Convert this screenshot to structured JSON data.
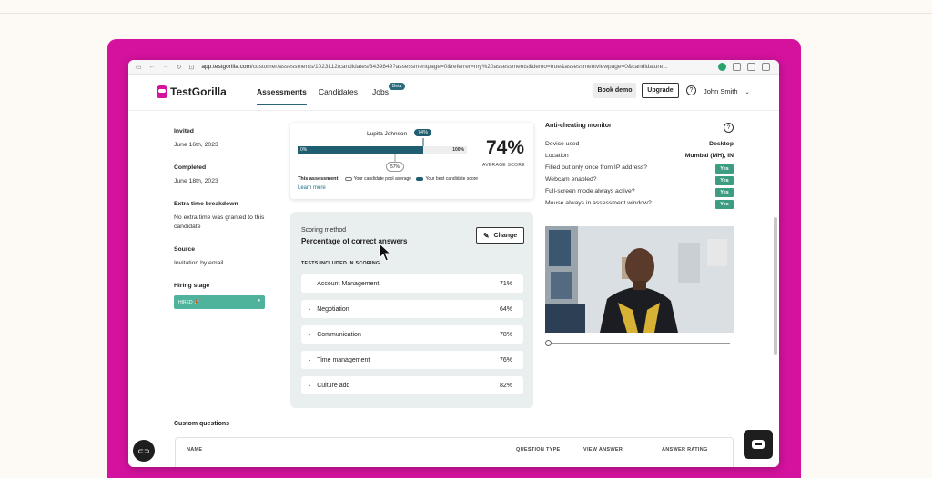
{
  "browser": {
    "url_host": "app.testgorilla.com",
    "url_path": "/customer/assessments/1023112/candidates/3439849?assessmentpage=0&referrer=my%20assessments&demo=true&assessmentviewpage=0&candidature..."
  },
  "header": {
    "logo": "TestGorilla",
    "nav": [
      "Assessments",
      "Candidates",
      "Jobs"
    ],
    "beta": "Beta",
    "book_demo": "Book demo",
    "upgrade": "Upgrade",
    "help": "?",
    "user": "John Smith"
  },
  "details": {
    "invited_label": "Invited",
    "invited_value": "June 16th, 2023",
    "completed_label": "Completed",
    "completed_value": "June 18th, 2023",
    "extra_label": "Extra time breakdown",
    "extra_value": "No extra time was granted to this candidate",
    "source_label": "Source",
    "source_value": "Invitation by email",
    "stage_label": "Hiring stage",
    "stage_value": "HIRED 🎉"
  },
  "score": {
    "candidate": "Lupita Johnson",
    "candidate_pct": "74%",
    "candidate_fraction": 0.74,
    "bar_min": "0%",
    "bar_max": "100%",
    "pool_avg": "57%",
    "big": "74%",
    "big_label": "AVERAGE SCORE",
    "legend_title": "This assessment:",
    "legend_pool": "Your candidate pool average",
    "legend_best": "Your best candidate score",
    "learn_more": "Learn more"
  },
  "scoring": {
    "method_label": "Scoring method",
    "method_value": "Percentage of correct answers",
    "change": "Change",
    "tests_label": "TESTS INCLUDED IN SCORING",
    "tests": [
      {
        "name": "Account Management",
        "pct": "71%"
      },
      {
        "name": "Negotiation",
        "pct": "64%"
      },
      {
        "name": "Communication",
        "pct": "78%"
      },
      {
        "name": "Time management",
        "pct": "76%"
      },
      {
        "name": "Culture add",
        "pct": "82%"
      }
    ]
  },
  "anticheat": {
    "title": "Anti-cheating monitor",
    "rows": [
      {
        "label": "Device used",
        "value": "Desktop"
      },
      {
        "label": "Location",
        "value": "Mumbai (MH), IN"
      },
      {
        "label": "Filled out only once from IP address?",
        "value": "Yes"
      },
      {
        "label": "Webcam enabled?",
        "value": "Yes"
      },
      {
        "label": "Full-screen mode always active?",
        "value": "Yes"
      },
      {
        "label": "Mouse always in assessment window?",
        "value": "Yes"
      }
    ]
  },
  "custom": {
    "title": "Custom questions",
    "columns": [
      "NAME",
      "QUESTION TYPE",
      "VIEW ANSWER",
      "ANSWER RATING"
    ]
  },
  "colors": {
    "magenta": "#d4129e",
    "teal": "#1f5d70",
    "green": "#3c9d83"
  }
}
